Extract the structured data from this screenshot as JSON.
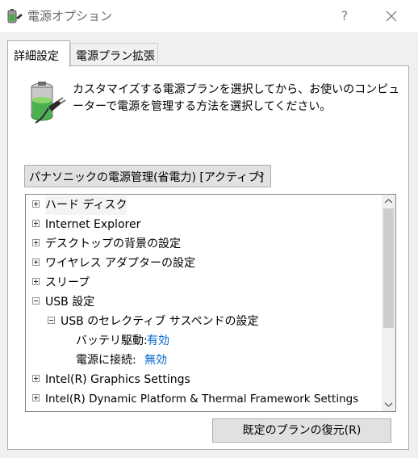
{
  "window": {
    "title": "電源オプション",
    "help_label": "?"
  },
  "tabs": [
    {
      "label": "詳細設定",
      "active": true
    },
    {
      "label": "電源プラン拡張",
      "active": false
    }
  ],
  "description": "カスタマイズする電源プランを選択してから、お使いのコンピューターで電源を管理する方法を選択してください。",
  "plan_select": {
    "value": "パナソニックの電源管理(省電力) [アクティブ]"
  },
  "tree": {
    "hard_disk": "ハード ディスク",
    "internet_explorer": "Internet Explorer",
    "desktop_background": "デスクトップの背景の設定",
    "wireless_adapter": "ワイヤレス アダプターの設定",
    "sleep": "スリープ",
    "usb_settings": "USB 設定",
    "usb_selective_suspend": "USB のセレクティブ サスペンドの設定",
    "on_battery_label": "バッテリ駆動:",
    "on_battery_value": "有効",
    "plugged_in_label": "電源に接続:",
    "plugged_in_value": "無効",
    "intel_graphics": "Intel(R) Graphics Settings",
    "intel_dptf": "Intel(R) Dynamic Platform & Thermal Framework Settings"
  },
  "buttons": {
    "restore_defaults": "既定のプランの復元(R)"
  },
  "colors": {
    "link_value": "#0066cc",
    "button_face": "#e1e1e1"
  },
  "icons": {
    "app": "power-options-icon",
    "battery": "battery-plug-icon"
  }
}
